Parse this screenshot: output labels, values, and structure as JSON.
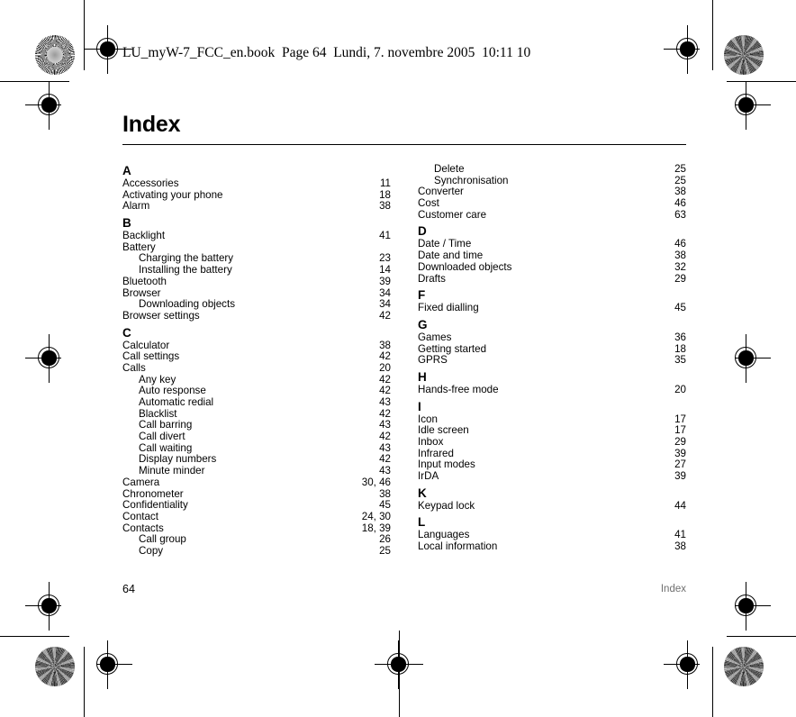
{
  "book_slug": "LU_myW-7_FCC_en.book  Page 64  Lundi, 7. novembre 2005  10:11 10",
  "page_title": "Index",
  "footer": {
    "folio": "64",
    "running_head": "Index",
    "running_head_color": "#6f6f6f"
  },
  "columns": [
    {
      "name": "left-column",
      "sections": [
        {
          "letter": "A",
          "entries": [
            {
              "label": "Accessories",
              "pages": "11",
              "sub": false
            },
            {
              "label": "Activating your phone",
              "pages": "18",
              "sub": false
            },
            {
              "label": "Alarm",
              "pages": "38",
              "sub": false
            }
          ]
        },
        {
          "letter": "B",
          "entries": [
            {
              "label": "Backlight",
              "pages": "41",
              "sub": false
            },
            {
              "label": "Battery",
              "pages": "",
              "sub": false
            },
            {
              "label": "Charging the battery",
              "pages": "23",
              "sub": true
            },
            {
              "label": "Installing the battery",
              "pages": "14",
              "sub": true
            },
            {
              "label": "Bluetooth",
              "pages": "39",
              "sub": false
            },
            {
              "label": "Browser",
              "pages": "34",
              "sub": false
            },
            {
              "label": "Downloading objects",
              "pages": "34",
              "sub": true
            },
            {
              "label": "Browser settings",
              "pages": "42",
              "sub": false
            }
          ]
        },
        {
          "letter": "C",
          "entries": [
            {
              "label": "Calculator",
              "pages": "38",
              "sub": false
            },
            {
              "label": "Call settings",
              "pages": "42",
              "sub": false
            },
            {
              "label": "Calls",
              "pages": "20",
              "sub": false
            },
            {
              "label": "Any key",
              "pages": "42",
              "sub": true
            },
            {
              "label": "Auto response",
              "pages": "42",
              "sub": true
            },
            {
              "label": "Automatic redial",
              "pages": "43",
              "sub": true
            },
            {
              "label": "Blacklist",
              "pages": "42",
              "sub": true
            },
            {
              "label": "Call barring",
              "pages": "43",
              "sub": true
            },
            {
              "label": "Call divert",
              "pages": "42",
              "sub": true
            },
            {
              "label": "Call waiting",
              "pages": "43",
              "sub": true
            },
            {
              "label": "Display numbers",
              "pages": "42",
              "sub": true
            },
            {
              "label": "Minute minder",
              "pages": "43",
              "sub": true
            },
            {
              "label": "Camera",
              "pages": "30, 46",
              "sub": false
            },
            {
              "label": "Chronometer",
              "pages": "38",
              "sub": false
            },
            {
              "label": "Confidentiality",
              "pages": "45",
              "sub": false
            },
            {
              "label": "Contact",
              "pages": "24, 30",
              "sub": false
            },
            {
              "label": "Contacts",
              "pages": "18, 39",
              "sub": false
            },
            {
              "label": "Call group",
              "pages": "26",
              "sub": true
            },
            {
              "label": "Copy",
              "pages": "25",
              "sub": true
            }
          ]
        }
      ]
    },
    {
      "name": "right-column",
      "sections": [
        {
          "letter": "",
          "entries": [
            {
              "label": "Delete",
              "pages": "25",
              "sub": true
            },
            {
              "label": "Synchronisation",
              "pages": "25",
              "sub": true
            },
            {
              "label": "Converter",
              "pages": "38",
              "sub": false
            },
            {
              "label": "Cost",
              "pages": "46",
              "sub": false
            },
            {
              "label": "Customer care",
              "pages": "63",
              "sub": false
            }
          ]
        },
        {
          "letter": "D",
          "entries": [
            {
              "label": "Date / Time",
              "pages": "46",
              "sub": false
            },
            {
              "label": "Date and time",
              "pages": "38",
              "sub": false
            },
            {
              "label": "Downloaded objects",
              "pages": "32",
              "sub": false
            },
            {
              "label": "Drafts",
              "pages": "29",
              "sub": false
            }
          ]
        },
        {
          "letter": "F",
          "entries": [
            {
              "label": "Fixed dialling",
              "pages": "45",
              "sub": false
            }
          ]
        },
        {
          "letter": "G",
          "entries": [
            {
              "label": "Games",
              "pages": "36",
              "sub": false
            },
            {
              "label": "Getting started",
              "pages": "18",
              "sub": false
            },
            {
              "label": "GPRS",
              "pages": "35",
              "sub": false
            }
          ]
        },
        {
          "letter": "H",
          "entries": [
            {
              "label": "Hands-free mode",
              "pages": "20",
              "sub": false
            }
          ]
        },
        {
          "letter": "I",
          "entries": [
            {
              "label": "Icon",
              "pages": "17",
              "sub": false
            },
            {
              "label": "Idle screen",
              "pages": "17",
              "sub": false
            },
            {
              "label": "Inbox",
              "pages": "29",
              "sub": false
            },
            {
              "label": "Infrared",
              "pages": "39",
              "sub": false
            },
            {
              "label": "Input modes",
              "pages": "27",
              "sub": false
            },
            {
              "label": "IrDA",
              "pages": "39",
              "sub": false
            }
          ]
        },
        {
          "letter": "K",
          "entries": [
            {
              "label": "Keypad lock",
              "pages": "44",
              "sub": false
            }
          ]
        },
        {
          "letter": "L",
          "entries": [
            {
              "label": "Languages",
              "pages": "41",
              "sub": false
            },
            {
              "label": "Local information",
              "pages": "38",
              "sub": false
            }
          ]
        }
      ]
    }
  ]
}
